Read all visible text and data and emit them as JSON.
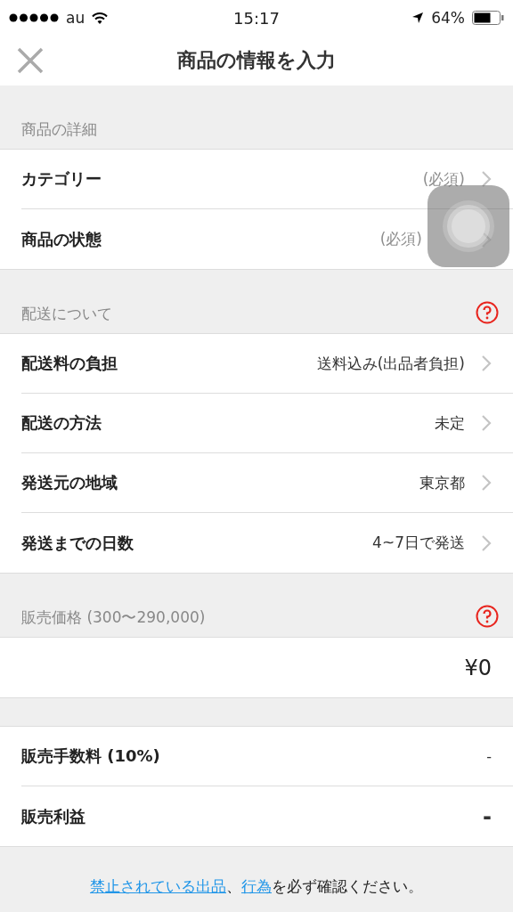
{
  "status_bar": {
    "carrier": "au",
    "time": "15:17",
    "battery": "64%"
  },
  "nav": {
    "title": "商品の情報を入力"
  },
  "sections": [
    {
      "header": "商品の詳細",
      "help": false,
      "rows": [
        {
          "kind": "select",
          "label": "カテゴリー",
          "value": "(必須)",
          "placeholder": true
        },
        {
          "kind": "select",
          "label": "商品の状態",
          "value": "(必須)",
          "placeholder": true
        }
      ]
    },
    {
      "header": "配送について",
      "help": true,
      "rows": [
        {
          "kind": "select",
          "label": "配送料の負担",
          "value": "送料込み(出品者負担)",
          "placeholder": false
        },
        {
          "kind": "select",
          "label": "配送の方法",
          "value": "未定",
          "placeholder": false
        },
        {
          "kind": "select",
          "label": "発送元の地域",
          "value": "東京都",
          "placeholder": false
        },
        {
          "kind": "select",
          "label": "発送までの日数",
          "value": "4~7日で発送",
          "placeholder": false
        }
      ]
    },
    {
      "header": "販売価格 (300〜290,000)",
      "help": true,
      "rows": [
        {
          "kind": "price",
          "value": "¥0"
        }
      ]
    },
    {
      "rows": [
        {
          "kind": "static",
          "label": "販売手数料 (10%)",
          "value": "-",
          "strong": false
        },
        {
          "kind": "static",
          "label": "販売利益",
          "value": "-",
          "strong": true
        }
      ]
    }
  ],
  "notice": [
    {
      "kind": "link",
      "text": "禁止されている出品"
    },
    {
      "kind": "plain",
      "text": "、"
    },
    {
      "kind": "link",
      "text": "行為"
    },
    {
      "kind": "plain",
      "text": "を必ず確認ください。"
    }
  ]
}
